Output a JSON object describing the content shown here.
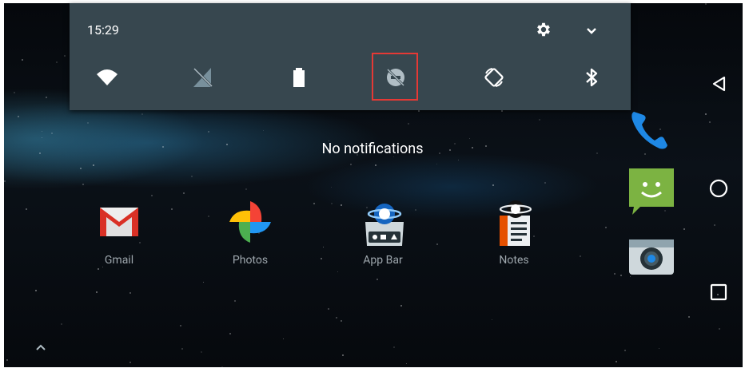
{
  "status": {
    "time": "15:29"
  },
  "quick_settings": {
    "tiles": [
      {
        "name": "wifi-icon"
      },
      {
        "name": "no-sim-signal-icon"
      },
      {
        "name": "battery-icon"
      },
      {
        "name": "do-not-disturb-off-icon",
        "highlighted": true
      },
      {
        "name": "auto-rotate-icon"
      },
      {
        "name": "bluetooth-icon"
      }
    ]
  },
  "shade": {
    "empty_text": "No notifications"
  },
  "home": {
    "apps": [
      {
        "label": "Gmail"
      },
      {
        "label": "Photos"
      },
      {
        "label": "App Bar"
      },
      {
        "label": "Notes"
      }
    ]
  },
  "colors": {
    "shade_bg": "#37474f",
    "highlight": "#e53935"
  }
}
